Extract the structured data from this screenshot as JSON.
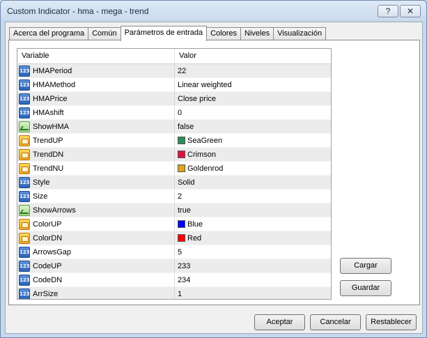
{
  "window": {
    "title": "Custom Indicator - hma - mega - trend",
    "help_label": "?",
    "close_label": "✕"
  },
  "tabs": [
    {
      "label": "Acerca del programa",
      "active": false
    },
    {
      "label": "Común",
      "active": false
    },
    {
      "label": "Parámetros de entrada",
      "active": true
    },
    {
      "label": "Colores",
      "active": false
    },
    {
      "label": "Niveles",
      "active": false
    },
    {
      "label": "Visualización",
      "active": false
    }
  ],
  "grid": {
    "col_variable": "Variable",
    "col_value": "Valor",
    "rows": [
      {
        "name": "HMAPeriod",
        "type": "int",
        "value": "22"
      },
      {
        "name": "HMAMethod",
        "type": "int",
        "value": "Linear weighted"
      },
      {
        "name": "HMAPrice",
        "type": "int",
        "value": "Close price"
      },
      {
        "name": "HMAshift",
        "type": "int",
        "value": "0"
      },
      {
        "name": "ShowHMA",
        "type": "bool",
        "value": "false"
      },
      {
        "name": "TrendUP",
        "type": "color",
        "value": "SeaGreen",
        "swatch": "#2e8b57"
      },
      {
        "name": "TrendDN",
        "type": "color",
        "value": "Crimson",
        "swatch": "#dc143c"
      },
      {
        "name": "TrendNU",
        "type": "color",
        "value": "Goldenrod",
        "swatch": "#daa520"
      },
      {
        "name": "Style",
        "type": "int",
        "value": "Solid"
      },
      {
        "name": "Size",
        "type": "int",
        "value": "2"
      },
      {
        "name": "ShowArrows",
        "type": "bool",
        "value": "true"
      },
      {
        "name": "ColorUP",
        "type": "color",
        "value": "Blue",
        "swatch": "#0000ff"
      },
      {
        "name": "ColorDN",
        "type": "color",
        "value": "Red",
        "swatch": "#ff0000"
      },
      {
        "name": "ArrowsGap",
        "type": "int",
        "value": "5"
      },
      {
        "name": "CodeUP",
        "type": "int",
        "value": "233"
      },
      {
        "name": "CodeDN",
        "type": "int",
        "value": "234"
      },
      {
        "name": "ArrSize",
        "type": "int",
        "value": "1"
      }
    ]
  },
  "side_buttons": {
    "load": "Cargar",
    "save": "Guardar"
  },
  "bottom_buttons": {
    "accept": "Aceptar",
    "cancel": "Cancelar",
    "reset": "Restablecer"
  }
}
